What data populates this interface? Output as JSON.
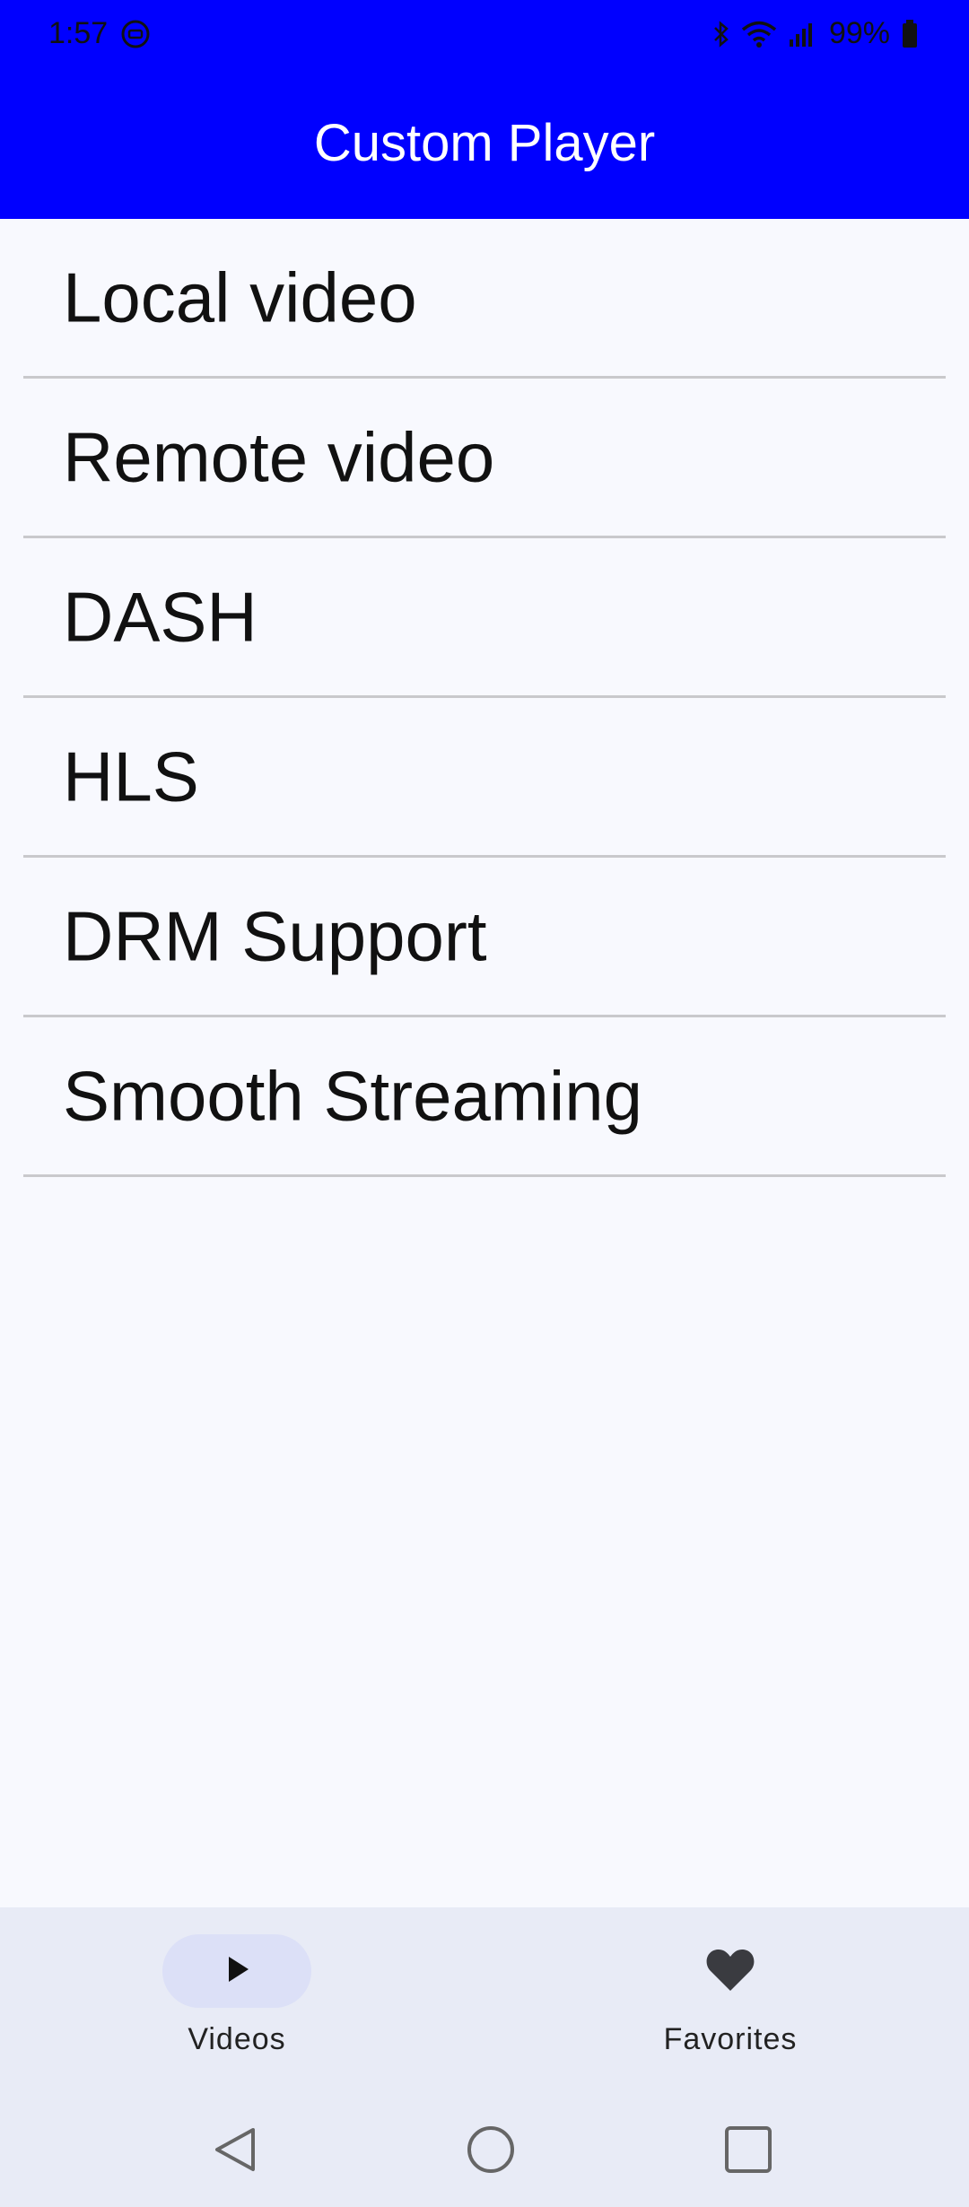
{
  "status_bar": {
    "time": "1:57",
    "battery": "99%",
    "icons": [
      "notification-icon",
      "bluetooth-icon",
      "wifi-icon",
      "signal-icon",
      "battery-icon"
    ]
  },
  "app_bar": {
    "title": "Custom Player",
    "color": "#0000FF"
  },
  "video_sources": [
    {
      "label": "Local video"
    },
    {
      "label": "Remote video"
    },
    {
      "label": "DASH"
    },
    {
      "label": "HLS"
    },
    {
      "label": "DRM Support"
    },
    {
      "label": "Smooth Streaming"
    }
  ],
  "bottom_nav": {
    "items": [
      {
        "label": "Videos",
        "icon": "play-icon",
        "selected": true
      },
      {
        "label": "Favorites",
        "icon": "heart-icon",
        "selected": false
      }
    ]
  },
  "system_nav": {
    "buttons": [
      "back-icon",
      "home-icon",
      "recents-icon"
    ]
  }
}
